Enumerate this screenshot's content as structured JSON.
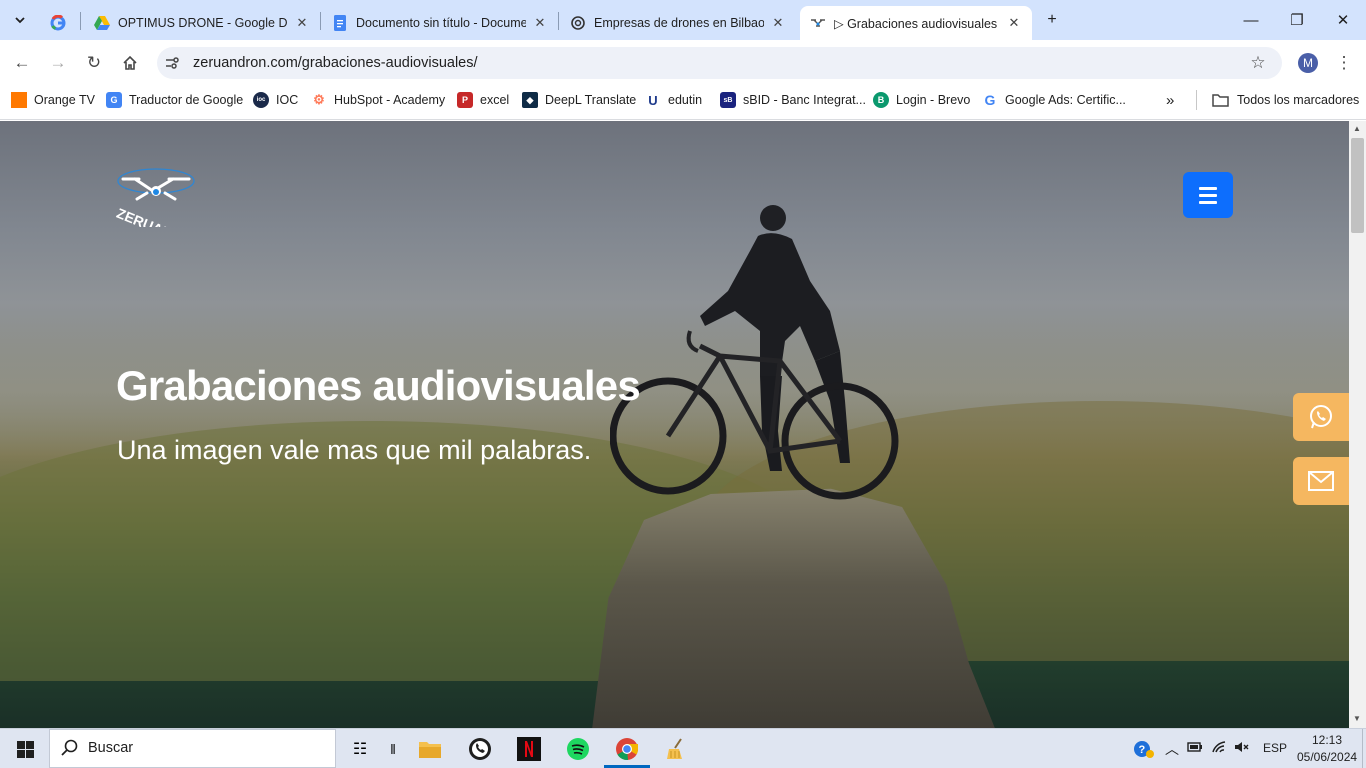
{
  "browser": {
    "tabs": [
      {
        "title": "OPTIMUS DRONE - Google Drive"
      },
      {
        "title": "Documento sin título - Documentos de Google"
      },
      {
        "title": "Empresas de drones en Bilbao"
      },
      {
        "title": "▷ Grabaciones audiovisuales y fotografía"
      }
    ],
    "url": "zeruandron.com/grabaciones-audiovisuales/",
    "profile_initial": "M",
    "bookmarks": [
      {
        "label": "Orange TV"
      },
      {
        "label": "Traductor de Google"
      },
      {
        "label": "IOC"
      },
      {
        "label": "HubSpot - Academy"
      },
      {
        "label": "excel"
      },
      {
        "label": "DeepL Translate"
      },
      {
        "label": "edutin"
      },
      {
        "label": "sBID - Banc Integrat..."
      },
      {
        "label": "Login - Brevo"
      },
      {
        "label": "Google Ads: Certific..."
      }
    ],
    "all_bookmarks": "Todos los marcadores"
  },
  "page": {
    "logo_text": "ZERUAN",
    "title": "Grabaciones audiovisuales",
    "subtitle": "Una imagen vale mas que mil palabras."
  },
  "taskbar": {
    "search_placeholder": "Buscar",
    "language": "ESP",
    "time": "12:13",
    "date": "05/06/2024"
  },
  "colors": {
    "accent": "#0d6efd",
    "side_buttons": "#f5b760",
    "tabbar": "#d3e3fd"
  }
}
